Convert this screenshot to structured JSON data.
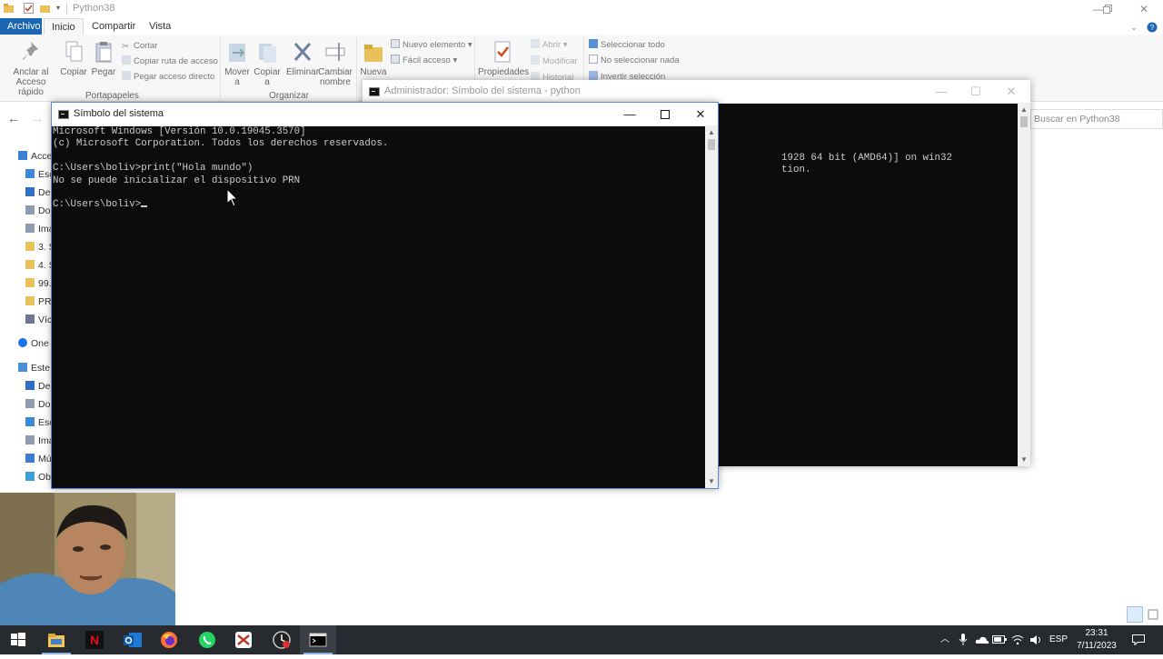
{
  "explorer": {
    "title": "Python38",
    "tabs": {
      "file": "Archivo",
      "home": "Inicio",
      "share": "Compartir",
      "view": "Vista"
    },
    "ribbon": {
      "pin": "Anclar al\nAcceso rápido",
      "pin_l1": "Anclar al",
      "pin_l2": "Acceso rápido",
      "copy": "Copiar",
      "paste": "Pegar",
      "cut": "Cortar",
      "copy_path": "Copiar ruta de acceso",
      "paste_shortcut": "Pegar acceso directo",
      "clipboard_group": "Portapapeles",
      "move_l1": "Mover",
      "move_l2": "a",
      "copyto_l1": "Copiar",
      "copyto_l2": "a",
      "delete": "Eliminar",
      "rename_l1": "Cambiar",
      "rename_l2": "nombre",
      "organize_group": "Organizar",
      "new_folder": "Nueva",
      "new_item": "Nuevo elemento",
      "easy_access": "Fácil acceso",
      "properties": "Propiedades",
      "open": "Abrir",
      "edit": "Modificar",
      "history": "Historial",
      "select_all": "Seleccionar todo",
      "select_none": "No seleccionar nada",
      "invert_selection": "Invertir selección"
    },
    "search_placeholder": "Buscar en Python38",
    "nav": [
      {
        "label": "Acce",
        "icon": "star-icon",
        "top": true
      },
      {
        "label": "Esc",
        "icon": "desktop-icon"
      },
      {
        "label": "De",
        "icon": "download-icon"
      },
      {
        "label": "Do",
        "icon": "document-icon"
      },
      {
        "label": "Ima",
        "icon": "image-icon"
      },
      {
        "label": "3. S",
        "icon": "folder-icon"
      },
      {
        "label": "4. S",
        "icon": "folder-icon"
      },
      {
        "label": "99.",
        "icon": "folder-icon"
      },
      {
        "label": "PR",
        "icon": "folder-icon"
      },
      {
        "label": "Víc",
        "icon": "video-icon"
      },
      {
        "label": "One",
        "icon": "cloud-icon",
        "top": true
      },
      {
        "label": "Este",
        "icon": "computer-icon",
        "top": true
      },
      {
        "label": "De",
        "icon": "download-icon"
      },
      {
        "label": "Do",
        "icon": "document-icon"
      },
      {
        "label": "Esc",
        "icon": "desktop-icon"
      },
      {
        "label": "Ima",
        "icon": "image-icon"
      },
      {
        "label": "Mú",
        "icon": "music-icon"
      },
      {
        "label": "Ob",
        "icon": "cube-icon"
      }
    ]
  },
  "cmd_admin": {
    "title": "Administrador: Símbolo del sistema - python",
    "lines": [
      "",
      "",
      "",
      "",
      "                                                                       1928 64 bit (AMD64)] on win32",
      "                                                                       tion."
    ]
  },
  "cmd_main": {
    "title": "Símbolo del sistema",
    "line1": "Microsoft Windows [Versión 10.0.19045.3570]",
    "line2": "(c) Microsoft Corporation. Todos los derechos reservados.",
    "line3": "",
    "line4": "C:\\Users\\boliv>print(\"Hola mundo\")",
    "line5": "No se puede inicializar el dispositivo PRN",
    "line6": "",
    "prompt": "C:\\Users\\boliv>"
  },
  "taskbar": {
    "apps": [
      "windows-start-icon",
      "file-explorer-icon",
      "netflix-icon",
      "outlook-icon",
      "firefox-icon",
      "whatsapp-icon",
      "app-icon",
      "clock-app-icon",
      "terminal-icon"
    ],
    "language": "ESP",
    "time": "23:31",
    "date": "7/11/2023"
  },
  "colors": {
    "file_tab": "#1a66b5",
    "console_bg": "#0c0c0c",
    "console_fg": "#cccccc",
    "taskbar": "#272b2f"
  }
}
